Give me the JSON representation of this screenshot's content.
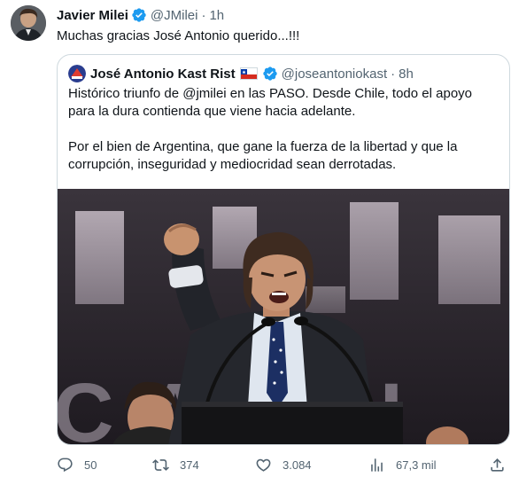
{
  "author": {
    "name": "Javier Milei",
    "handle": "@JMilei",
    "time": "1h"
  },
  "tweet": {
    "text": "Muchas gracias José Antonio querido...!!!"
  },
  "quoted": {
    "name": "José Antonio Kast Rist",
    "handle": "@joseantoniokast",
    "time": "8h",
    "paragraph1": "Histórico triunfo de @jmilei en las PASO. Desde Chile, todo el apoyo para la dura contienda que viene hacia adelante.",
    "paragraph2": "Por el bien de Argentina, que gane la fuerza de la libertad y que la corrupción, inseguridad y mediocridad sean derrotadas.",
    "image_backdrop_text": "CA  CI"
  },
  "actions": {
    "replies": "50",
    "retweets": "374",
    "likes": "3.084",
    "views": "67,3 mil"
  },
  "colors": {
    "verified": "#1d9bf0",
    "muted": "#536471",
    "border": "#cfd9de"
  }
}
